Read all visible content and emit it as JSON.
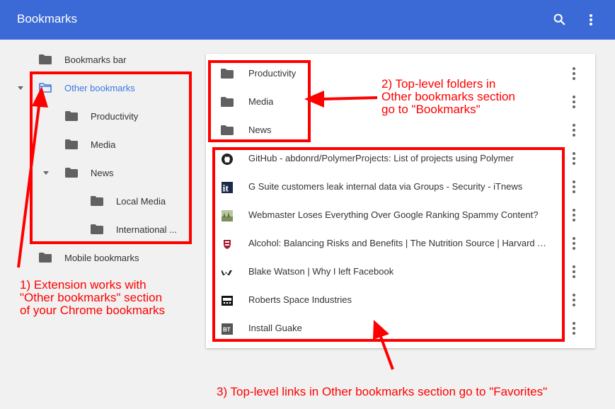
{
  "header": {
    "title": "Bookmarks",
    "color": "#3b6ad6"
  },
  "sidebar": {
    "items": [
      {
        "label": "Bookmarks bar",
        "icon": "folder-icon"
      },
      {
        "label": "Other bookmarks",
        "icon": "folder-open-icon",
        "selected": true,
        "expanded": true
      },
      {
        "label": "Productivity",
        "icon": "folder-icon"
      },
      {
        "label": "Media",
        "icon": "folder-icon"
      },
      {
        "label": "News",
        "icon": "folder-icon",
        "expanded": true
      },
      {
        "label": "Local Media",
        "icon": "folder-icon"
      },
      {
        "label": "International ...",
        "icon": "folder-icon"
      },
      {
        "label": "Mobile bookmarks",
        "icon": "folder-icon"
      }
    ]
  },
  "list": {
    "folders": [
      {
        "label": "Productivity",
        "icon": "folder-icon"
      },
      {
        "label": "Media",
        "icon": "folder-icon"
      },
      {
        "label": "News",
        "icon": "folder-icon"
      }
    ],
    "links": [
      {
        "label": "GitHub - abdonrd/PolymerProjects: List of projects using Polymer",
        "icon": "github-favicon-icon"
      },
      {
        "label": "G Suite customers leak internal data via Groups - Security - iTnews",
        "icon": "itnews-favicon-icon",
        "favicon_text": "it"
      },
      {
        "label": "Webmaster Loses Everything Over Google Ranking Spammy Content?",
        "icon": "landscape-favicon-icon"
      },
      {
        "label": "Alcohol: Balancing Risks and Benefits | The Nutrition Source | Harvard T....",
        "icon": "harvard-shield-favicon-icon"
      },
      {
        "label": "Blake Watson | Why I left Facebook",
        "icon": "w-logo-favicon-icon"
      },
      {
        "label": "Roberts Space Industries",
        "icon": "rsi-favicon-icon"
      },
      {
        "label": "Install Guake",
        "icon": "bt-favicon-icon",
        "favicon_text": "BT"
      }
    ]
  },
  "annotations": {
    "note1": "1) Extension works with\n\"Other bookmarks\" section\nof your Chrome bookmarks",
    "note2": "2) Top-level folders in\nOther bookmarks section\ngo to \"Bookmarks\"",
    "note3": "3) Top-level links in Other bookmarks section go to \"Favorites\"",
    "color": "#ff0000"
  }
}
